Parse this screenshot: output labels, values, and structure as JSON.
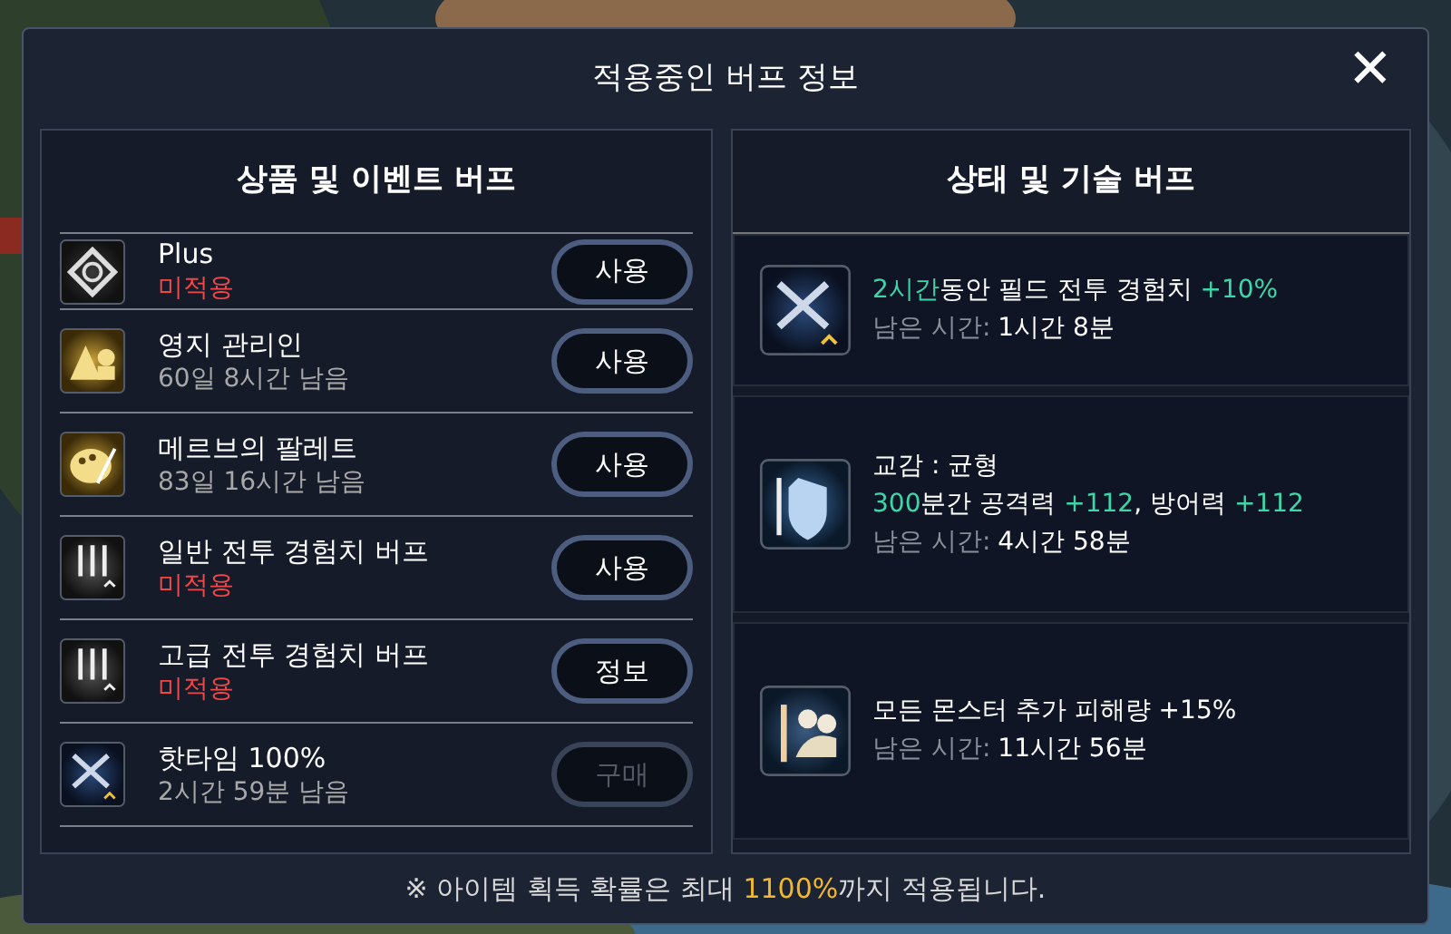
{
  "dialog": {
    "title": "적용중인 버프 정보",
    "close": "✕"
  },
  "product_buffs": {
    "heading": "상품 및 이벤트 버프",
    "items": [
      {
        "title": "Plus",
        "status": "미적용",
        "applied": false,
        "button": {
          "label": "사용",
          "disabled": false
        }
      },
      {
        "title": "영지 관리인",
        "status": "60일 8시간 남음",
        "applied": true,
        "button": {
          "label": "사용",
          "disabled": false
        }
      },
      {
        "title": "메르브의 팔레트",
        "status": "83일 16시간 남음",
        "applied": true,
        "button": {
          "label": "사용",
          "disabled": false
        }
      },
      {
        "title": "일반 전투 경험치 버프",
        "status": "미적용",
        "applied": false,
        "button": {
          "label": "사용",
          "disabled": false
        }
      },
      {
        "title": "고급 전투 경험치 버프",
        "status": "미적용",
        "applied": false,
        "button": {
          "label": "정보",
          "disabled": false
        }
      },
      {
        "title": "핫타임 100%",
        "status": "2시간 59분 남음",
        "applied": true,
        "button": {
          "label": "구매",
          "disabled": true
        }
      }
    ]
  },
  "status_buffs": {
    "heading": "상태 및 기술 버프",
    "items": [
      {
        "effect": [
          {
            "text": "2시간",
            "highlight": true
          },
          {
            "text": "동안 필드 전투 경험치 ",
            "highlight": false
          },
          {
            "text": "+10%",
            "highlight": true
          }
        ],
        "remaining_label": "남은 시간:",
        "remaining": "1시간 8분"
      },
      {
        "title": "교감 : 균형",
        "effect": [
          {
            "text": "300",
            "highlight": true
          },
          {
            "text": "분간 공격력 ",
            "highlight": false
          },
          {
            "text": "+112",
            "highlight": true
          },
          {
            "text": ", 방어력 ",
            "highlight": false
          },
          {
            "text": "+112",
            "highlight": true
          }
        ],
        "remaining_label": "남은 시간:",
        "remaining": "4시간 58분"
      },
      {
        "effect": [
          {
            "text": "모든 몬스터 추가 피해량 +15%",
            "highlight": false
          }
        ],
        "remaining_label": "남은 시간:",
        "remaining": "11시간 56분"
      }
    ]
  },
  "footer": [
    {
      "text": "※ 아이템 획득 확률은 최대 ",
      "highlight": false
    },
    {
      "text": "1100%",
      "highlight": true
    },
    {
      "text": "까지 적용됩니다.",
      "highlight": false
    }
  ]
}
